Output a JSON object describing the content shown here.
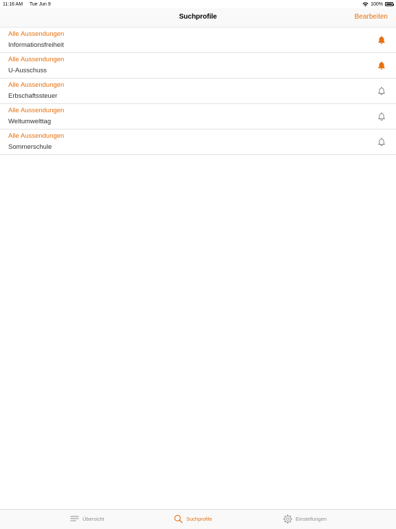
{
  "status_bar": {
    "time": "11:16 AM",
    "date": "Tue Jun 9",
    "battery": "100%"
  },
  "nav": {
    "title": "Suchprofile",
    "edit_label": "Bearbeiten"
  },
  "profiles": [
    {
      "subtitle": "Alle Aussendungen",
      "title": "Informationsfreiheit",
      "notifications": true
    },
    {
      "subtitle": "Alle Aussendungen",
      "title": "U-Ausschuss",
      "notifications": true
    },
    {
      "subtitle": "Alle Aussendungen",
      "title": "Erbschaftssteuer",
      "notifications": false
    },
    {
      "subtitle": "Alle Aussendungen",
      "title": "Weltumwelttag",
      "notifications": false
    },
    {
      "subtitle": "Alle Aussendungen",
      "title": "Sommerschule",
      "notifications": false
    }
  ],
  "tabs": [
    {
      "label": "Übersicht",
      "icon": "list-icon",
      "active": false
    },
    {
      "label": "Suchprofile",
      "icon": "search-icon",
      "active": true
    },
    {
      "label": "Einstellungen",
      "icon": "gear-icon",
      "active": false
    }
  ],
  "colors": {
    "accent": "#e8700e",
    "inactive": "#8e8e93"
  }
}
